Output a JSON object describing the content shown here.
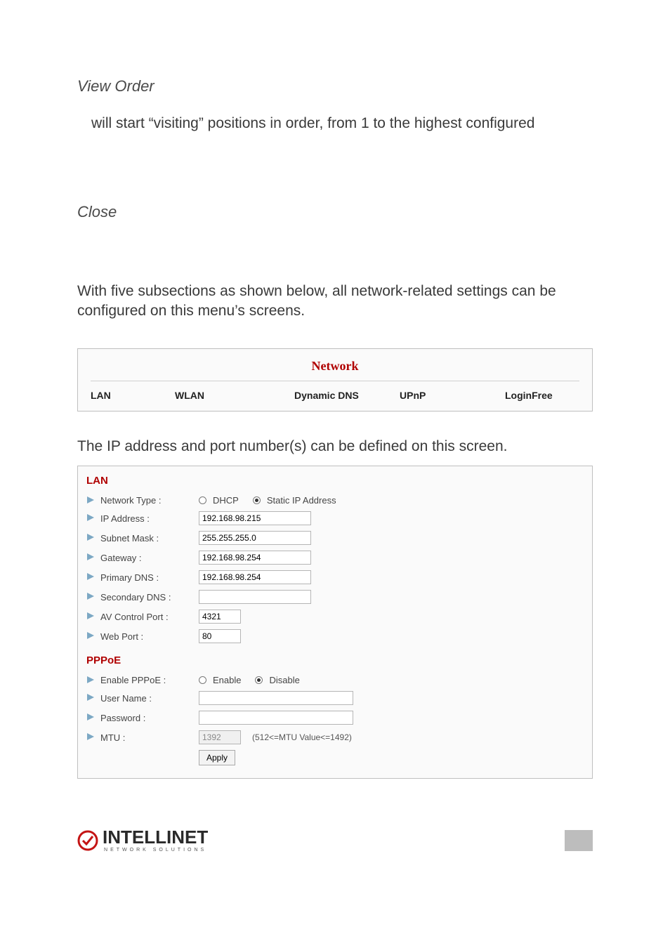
{
  "sections": {
    "view_order_title": "View Order",
    "view_order_body": "will start “visiting” positions in order, from 1 to the highest configured",
    "close_title": "Close",
    "network_intro": "With five subsections as shown below, all network-related settings can be configured on this menu’s screens.",
    "lan_intro": "The IP address and port number(s) can be defined on this screen."
  },
  "network": {
    "title": "Network",
    "tabs": [
      "LAN",
      "WLAN",
      "Dynamic DNS",
      "UPnP",
      "LoginFree"
    ]
  },
  "lan": {
    "section": "LAN",
    "fields": {
      "network_type": {
        "label": "Network Type :",
        "options": [
          "DHCP",
          "Static IP Address"
        ],
        "selected": "Static IP Address"
      },
      "ip_address": {
        "label": "IP Address :",
        "value": "192.168.98.215"
      },
      "subnet_mask": {
        "label": "Subnet Mask :",
        "value": "255.255.255.0"
      },
      "gateway": {
        "label": "Gateway :",
        "value": "192.168.98.254"
      },
      "primary_dns": {
        "label": "Primary DNS :",
        "value": "192.168.98.254"
      },
      "secondary_dns": {
        "label": "Secondary DNS :",
        "value": ""
      },
      "av_port": {
        "label": "AV Control Port :",
        "value": "4321"
      },
      "web_port": {
        "label": "Web Port :",
        "value": "80"
      }
    }
  },
  "pppoe": {
    "section": "PPPoE",
    "fields": {
      "enable": {
        "label": "Enable PPPoE :",
        "options": [
          "Enable",
          "Disable"
        ],
        "selected": "Disable"
      },
      "username": {
        "label": "User Name :",
        "value": ""
      },
      "password": {
        "label": "Password :",
        "value": ""
      },
      "mtu": {
        "label": "MTU :",
        "value": "1392",
        "hint": "(512<=MTU Value<=1492)"
      }
    },
    "apply": "Apply"
  },
  "logo": {
    "brand": "INTELLINET",
    "tagline": "NETWORK SOLUTIONS"
  }
}
